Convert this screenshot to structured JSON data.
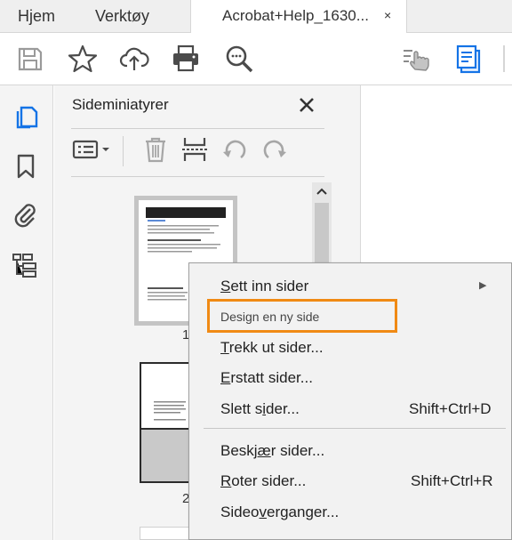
{
  "tabs": {
    "home_label": "Hjem",
    "tools_label": "Verktøy",
    "document_label": "Acrobat+Help_1630...",
    "document_close": "×"
  },
  "toolbar": {
    "icons": [
      "save-icon",
      "bookmark-star-icon",
      "cloud-upload-icon",
      "print-icon",
      "zoom-search-icon",
      "hand-pointer-icon",
      "page-tools-icon"
    ]
  },
  "rail": {
    "icons": [
      "page-thumbnails-icon",
      "bookmark-icon",
      "attachment-icon",
      "layers-structure-icon"
    ]
  },
  "panel": {
    "title": "Sideminiatyrer",
    "close": "×",
    "thumbnails": [
      {
        "page_label": "1"
      },
      {
        "page_label": "2"
      }
    ]
  },
  "context_menu": {
    "items": [
      {
        "pre": "",
        "mnemonic": "S",
        "post": "ett inn sider",
        "shortcut": "",
        "submenu": true
      },
      {
        "pre": "Design en ny side",
        "mnemonic": "",
        "post": "",
        "shortcut": "",
        "submenu": false
      },
      {
        "pre": "",
        "mnemonic": "T",
        "post": "rekk ut sider...",
        "shortcut": "",
        "submenu": false
      },
      {
        "pre": "",
        "mnemonic": "E",
        "post": "rstatt sider...",
        "shortcut": "",
        "submenu": false
      },
      {
        "pre": "Slett s",
        "mnemonic": "i",
        "post": "der...",
        "shortcut": "Shift+Ctrl+D",
        "submenu": false
      },
      {
        "pre": "Beskj",
        "mnemonic": "æ",
        "post": "r sider...",
        "shortcut": "",
        "submenu": false
      },
      {
        "pre": "",
        "mnemonic": "R",
        "post": "oter sider...",
        "shortcut": "Shift+Ctrl+R",
        "submenu": false
      },
      {
        "pre": "Sideo",
        "mnemonic": "v",
        "post": "erganger...",
        "shortcut": "",
        "submenu": false
      }
    ],
    "highlight_color": "#f08a14"
  },
  "colors": {
    "accent_blue": "#1473e6",
    "icon_gray": "#4b4b4b",
    "panel_bg": "#f4f4f4",
    "menu_bg": "#f2f2f2"
  }
}
